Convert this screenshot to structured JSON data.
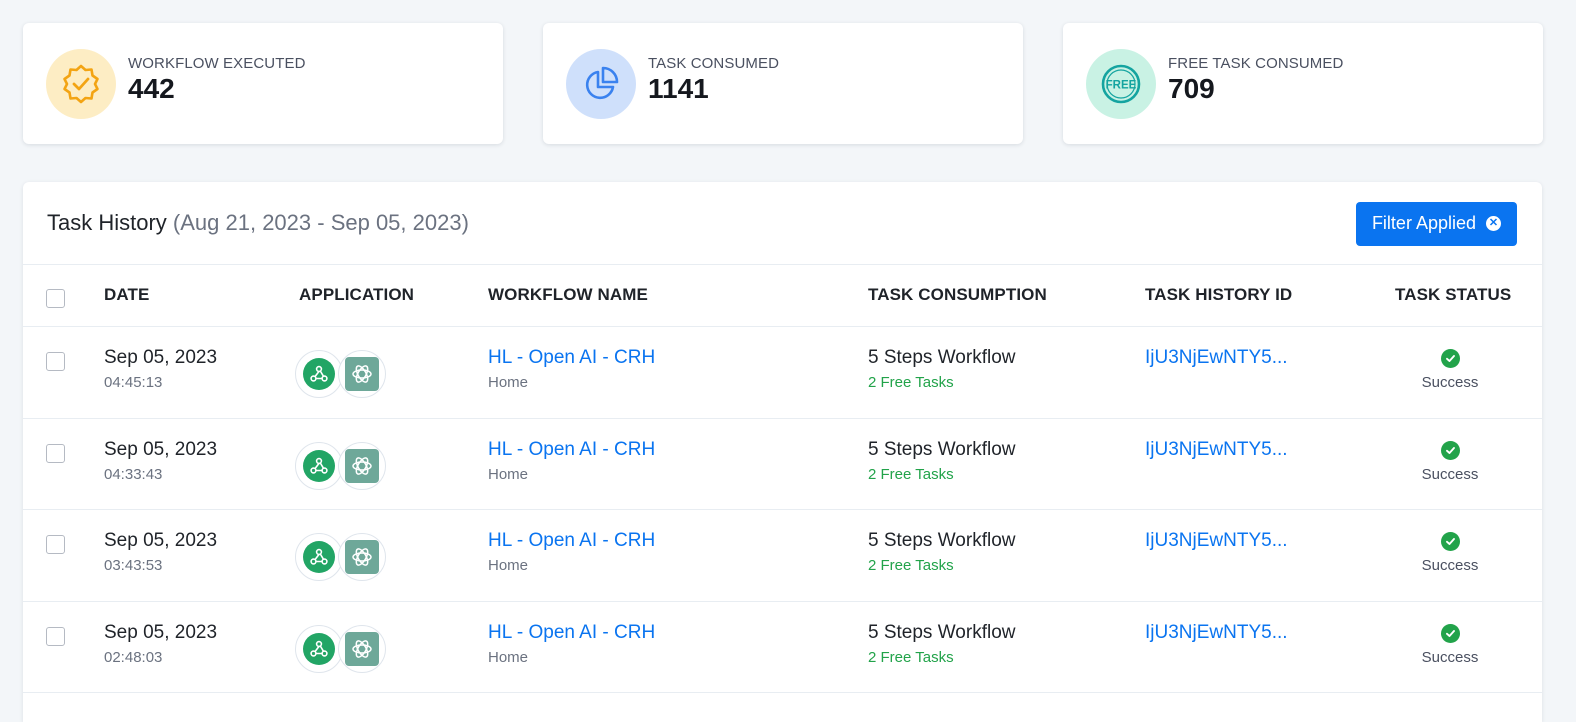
{
  "stats": [
    {
      "label": "WORKFLOW EXECUTED",
      "value": "442",
      "icon": "badge-check-icon",
      "bg": "#fdedc4",
      "color": "#f3a413"
    },
    {
      "label": "TASK CONSUMED",
      "value": "1141",
      "icon": "pie-chart-icon",
      "bg": "#cfe0fb",
      "color": "#3a82ef"
    },
    {
      "label": "FREE TASK CONSUMED",
      "value": "709",
      "icon": "free-icon",
      "bg": "#c9f2e4",
      "color": "#14a4a0"
    }
  ],
  "task_history": {
    "title": "Task History",
    "range": "(Aug 21, 2023 - Sep 05, 2023)",
    "filter_label": "Filter Applied",
    "columns": {
      "date": "DATE",
      "application": "APPLICATION",
      "workflow_name": "WORKFLOW NAME",
      "task_consumption": "TASK CONSUMPTION",
      "task_history_id": "TASK HISTORY ID",
      "task_status": "TASK STATUS"
    },
    "rows": [
      {
        "date": "Sep 05, 2023",
        "time": "04:45:13",
        "workflow": "HL - Open AI - CRH",
        "folder": "Home",
        "consumption": "5 Steps Workflow",
        "free": "2 Free Tasks",
        "id": "IjU3NjEwNTY5...",
        "status": "Success"
      },
      {
        "date": "Sep 05, 2023",
        "time": "04:33:43",
        "workflow": "HL - Open AI - CRH",
        "folder": "Home",
        "consumption": "5 Steps Workflow",
        "free": "2 Free Tasks",
        "id": "IjU3NjEwNTY5...",
        "status": "Success"
      },
      {
        "date": "Sep 05, 2023",
        "time": "03:43:53",
        "workflow": "HL - Open AI - CRH",
        "folder": "Home",
        "consumption": "5 Steps Workflow",
        "free": "2 Free Tasks",
        "id": "IjU3NjEwNTY5...",
        "status": "Success"
      },
      {
        "date": "Sep 05, 2023",
        "time": "02:48:03",
        "workflow": "HL - Open AI - CRH",
        "folder": "Home",
        "consumption": "5 Steps Workflow",
        "free": "2 Free Tasks",
        "id": "IjU3NjEwNTY5...",
        "status": "Success"
      }
    ]
  },
  "colors": {
    "accent": "#0a74f0",
    "success": "#22a34a",
    "webhook": "#22a565",
    "openai": "#6ea899"
  }
}
